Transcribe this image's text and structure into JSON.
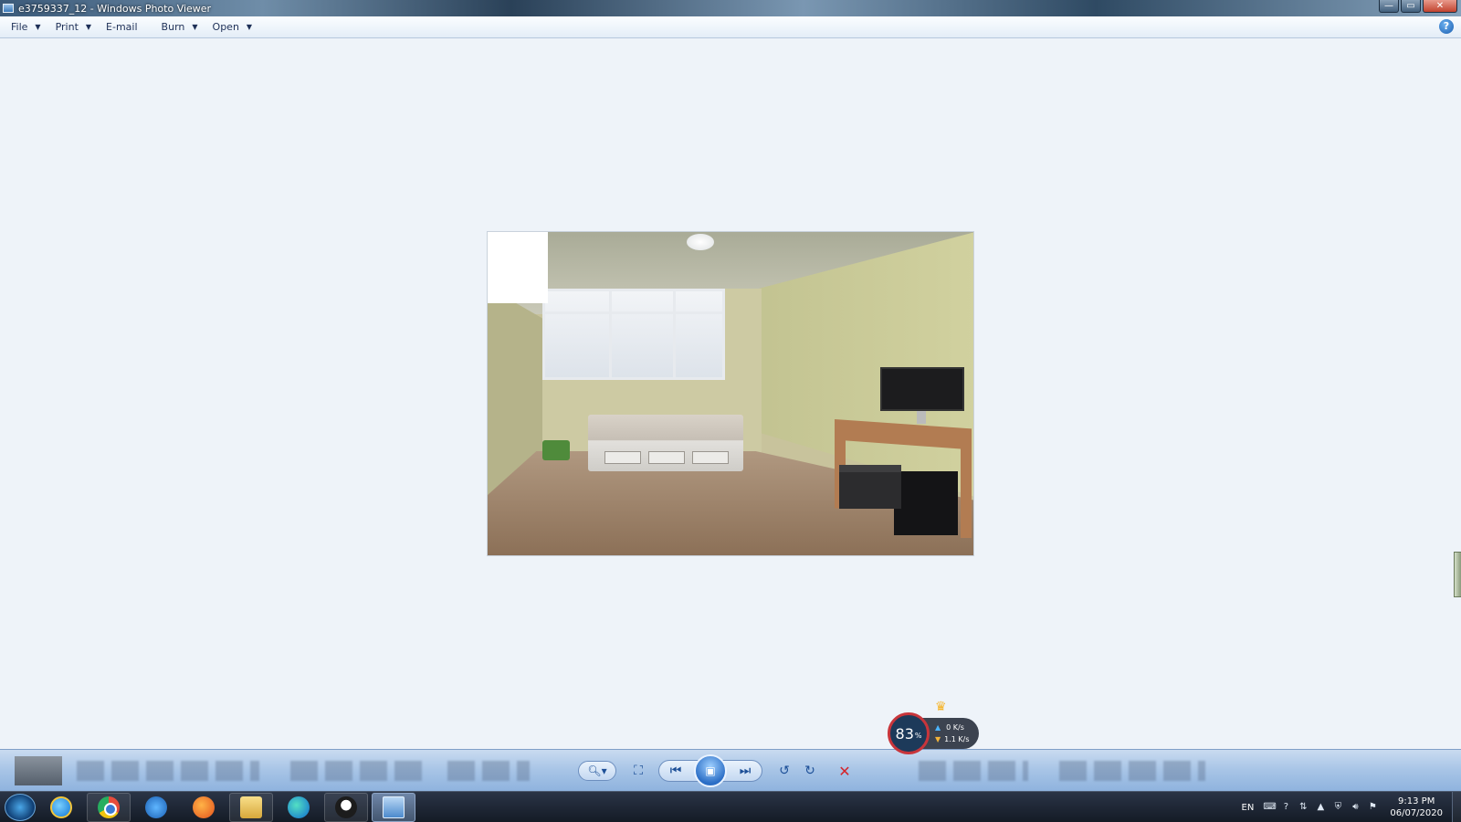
{
  "window": {
    "title": "e3759337_12 - Windows Photo Viewer",
    "controls": {
      "minimize": "—",
      "maximize": "▭",
      "close": "✕"
    }
  },
  "menu": {
    "items": [
      {
        "label": "File",
        "has_caret": true
      },
      {
        "label": "Print",
        "has_caret": true
      },
      {
        "label": "E-mail",
        "has_caret": false
      },
      {
        "label": "Burn",
        "has_caret": true
      },
      {
        "label": "Open",
        "has_caret": true
      }
    ],
    "help_icon": "?"
  },
  "photo": {
    "subject": "bedroom with bed, window, desk with monitor, printer and computer tower"
  },
  "net_widget": {
    "percent": "83",
    "percent_unit": "%",
    "upload": "0 K/s",
    "download": "1.1 K/s"
  },
  "controls": {
    "zoom_icon": "magnifier-icon",
    "fit_icon": "actual-size-icon",
    "previous_icon": "previous-icon",
    "slideshow_icon": "slideshow-icon",
    "next_icon": "next-icon",
    "rotate_ccw_icon": "rotate-counterclockwise-icon",
    "rotate_cw_icon": "rotate-clockwise-icon",
    "delete_icon": "delete-icon"
  },
  "taskbar": {
    "apps": [
      "Internet Explorer",
      "Google Chrome",
      "Internet Explorer",
      "Firefox",
      "File Explorer",
      "Microsoft Edge",
      "QQ",
      "Windows Photo Viewer"
    ],
    "tray": {
      "language": "EN",
      "time": "9:13 PM",
      "date": "06/07/2020"
    }
  },
  "colors": {
    "background": "#eef3f9",
    "control_bar": "#a7c4e6",
    "taskbar": "#1b2431",
    "gauge_ring": "#c8353b"
  }
}
